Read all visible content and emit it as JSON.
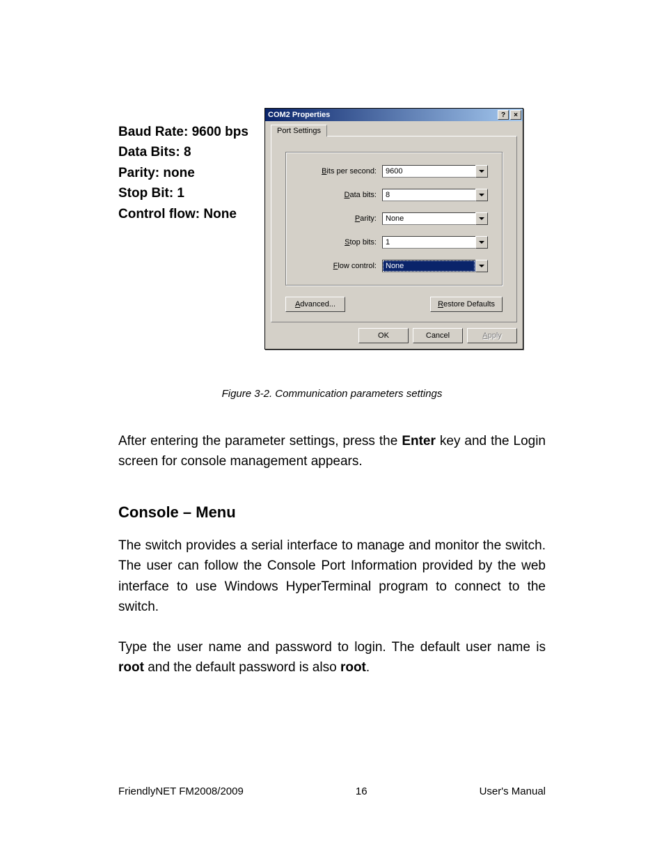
{
  "params": {
    "baud": "Baud Rate: 9600 bps",
    "databits": "Data Bits: 8",
    "parity": "Parity: none",
    "stopbit": "Stop Bit: 1",
    "flow": "Control flow: None"
  },
  "dialog": {
    "title": "COM2 Properties",
    "help": "?",
    "close": "×",
    "tab": "Port Settings",
    "fields": {
      "bps": {
        "label_pre": "B",
        "label_rest": "its per second:",
        "value": "9600",
        "selected": false
      },
      "data": {
        "label_pre": "D",
        "label_rest": "ata bits:",
        "value": "8",
        "selected": false
      },
      "parity": {
        "label_pre": "P",
        "label_rest": "arity:",
        "value": "None",
        "selected": false
      },
      "stop": {
        "label_pre": "S",
        "label_rest": "top bits:",
        "value": "1",
        "selected": false
      },
      "flow": {
        "label_pre": "F",
        "label_rest": "low control:",
        "value": "None",
        "selected": true
      }
    },
    "advanced_pre": "A",
    "advanced_rest": "dvanced...",
    "restore_pre": "R",
    "restore_rest": "estore Defaults",
    "ok": "OK",
    "cancel": "Cancel",
    "apply_pre": "A",
    "apply_rest": "pply"
  },
  "figure_caption": "Figure 3-2.  Communication parameters settings",
  "para1_a": "After entering the parameter settings, press the ",
  "para1_b": "Enter",
  "para1_c": " key and the Login screen for console management appears.",
  "section_heading": "Console – Menu",
  "para2": "The switch provides a serial interface to manage and monitor the switch. The user can follow the Console Port Information provided by the web interface to use Windows HyperTerminal program to connect to the switch.",
  "para3_a": "Type the user name and password to login. The default user name is ",
  "para3_b": "root",
  "para3_c": " and the default password is also ",
  "para3_d": "root",
  "para3_e": ".",
  "footer": {
    "left": "FriendlyNET FM2008/2009",
    "center": "16",
    "right": "User's Manual"
  }
}
